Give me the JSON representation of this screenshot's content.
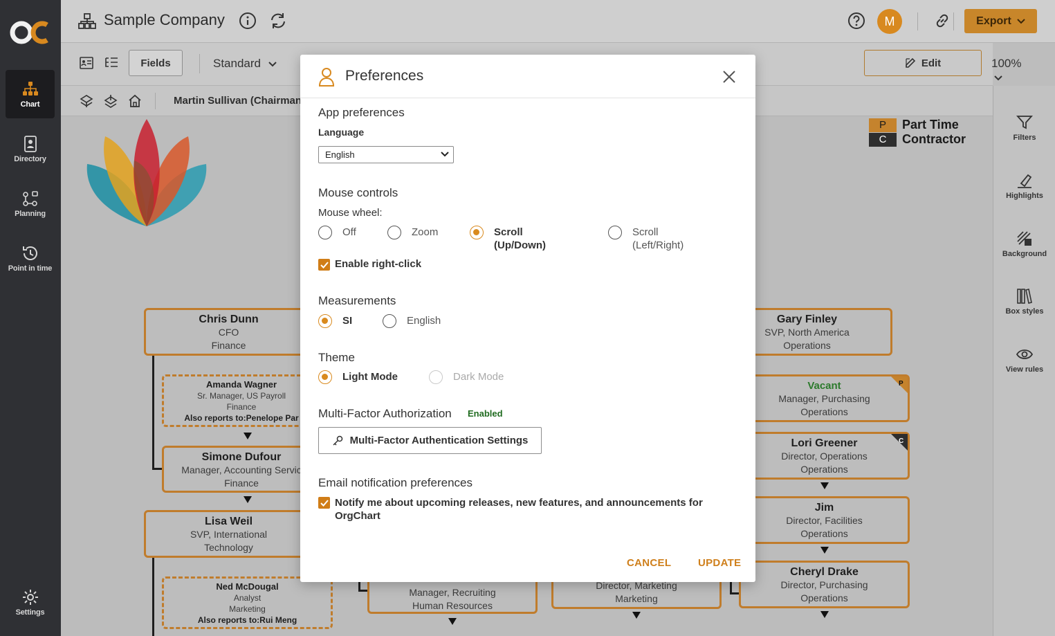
{
  "app": {
    "company": "Sample Company",
    "avatar_initial": "M",
    "export_label": "Export",
    "brand_color": "#d8891f"
  },
  "rail": {
    "items": [
      {
        "label": "Chart"
      },
      {
        "label": "Directory"
      },
      {
        "label": "Planning"
      },
      {
        "label": "Point in time"
      }
    ],
    "settings_label": "Settings"
  },
  "toolbar": {
    "fields_label": "Fields",
    "view_label": "Standard",
    "edit_label": "Edit",
    "zoom_label": "100%"
  },
  "breadcrumb": {
    "text": "Martin Sullivan (Chairman"
  },
  "right_rail": {
    "items": [
      {
        "label": "Filters"
      },
      {
        "label": "Highlights"
      },
      {
        "label": "Background"
      },
      {
        "label": "Box styles"
      },
      {
        "label": "View rules"
      }
    ]
  },
  "legend": {
    "items": [
      {
        "code": "P",
        "label": "Part Time"
      },
      {
        "code": "C",
        "label": "Contractor"
      }
    ]
  },
  "chart_nodes": [
    {
      "name": "Chris  Dunn",
      "title": "CFO",
      "dept": "Finance"
    },
    {
      "name": "Amanda Wagner",
      "title": "Sr. Manager, US Payroll",
      "dept": "Finance",
      "extra": "Also reports to:Penelope Par"
    },
    {
      "name": "Simone Dufour",
      "title": "Manager, Accounting Servic",
      "dept": "Finance"
    },
    {
      "name": "Lisa Weil",
      "title": "SVP, International",
      "dept": "Technology"
    },
    {
      "name": "Ned McDougal",
      "title": "Analyst",
      "dept": "Marketing",
      "extra": "Also reports to:Rui Meng"
    },
    {
      "title": "Manager, Recruiting",
      "dept": "Human Resources"
    },
    {
      "title": "Director, Marketing",
      "dept": "Marketing"
    },
    {
      "name": "Gary Finley",
      "title": "SVP, North America",
      "dept": "Operations"
    },
    {
      "name": "Vacant",
      "title": "Manager, Purchasing",
      "dept": "Operations",
      "badge": "P"
    },
    {
      "name": "Lori Greener",
      "title": "Director, Operations",
      "dept": "Operations",
      "badge": "C"
    },
    {
      "name": "Jim",
      "title": "Director, Facilities",
      "dept": "Operations"
    },
    {
      "name": "Cheryl Drake",
      "title": "Director, Purchasing",
      "dept": "Operations"
    }
  ],
  "modal": {
    "title": "Preferences",
    "app_prefs": {
      "heading": "App preferences",
      "language_label": "Language",
      "language_value": "English"
    },
    "mouse": {
      "heading": "Mouse controls",
      "wheel_label": "Mouse wheel:",
      "options": [
        {
          "label": "Off",
          "selected": false
        },
        {
          "label": "Zoom",
          "selected": false
        },
        {
          "label": "Scroll",
          "sub": "(Up/Down)",
          "selected": true
        },
        {
          "label": "Scroll",
          "sub": "(Left/Right)",
          "selected": false
        }
      ],
      "right_click_label": "Enable right-click",
      "right_click_checked": true
    },
    "measurements": {
      "heading": "Measurements",
      "options": [
        {
          "label": "SI",
          "selected": true
        },
        {
          "label": "English",
          "selected": false
        }
      ]
    },
    "theme": {
      "heading": "Theme",
      "options": [
        {
          "label": "Light Mode",
          "selected": true
        },
        {
          "label": "Dark Mode",
          "selected": false,
          "disabled": true
        }
      ]
    },
    "mfa": {
      "heading": "Multi-Factor Authorization",
      "status": "Enabled",
      "button_label": "Multi-Factor Authentication Settings"
    },
    "email": {
      "heading": "Email notification preferences",
      "notify_line1": "Notify me about upcoming releases, new features, and announcements for",
      "notify_line2": "OrgChart",
      "notify_checked": true
    },
    "cancel_label": "CANCEL",
    "update_label": "UPDATE"
  }
}
